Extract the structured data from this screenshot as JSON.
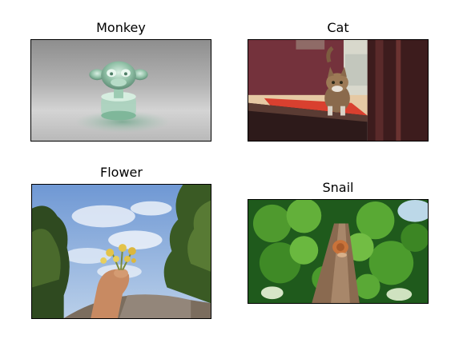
{
  "figure": {
    "panels": [
      {
        "title": "Monkey",
        "image": "glass-monkey-render"
      },
      {
        "title": "Cat",
        "image": "cat-in-doorway-photo"
      },
      {
        "title": "Flower",
        "image": "hand-holding-flowers-photo"
      },
      {
        "title": "Snail",
        "image": "snail-on-tree-trunk-photo"
      }
    ]
  }
}
